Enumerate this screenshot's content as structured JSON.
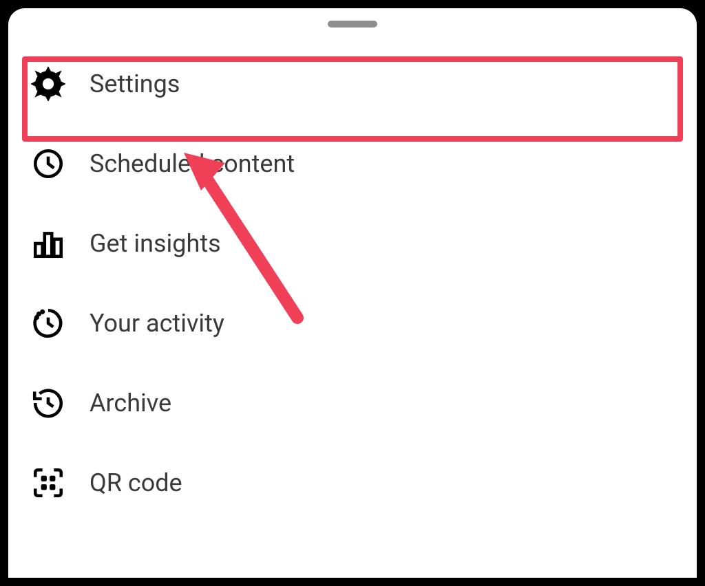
{
  "menu": {
    "items": [
      {
        "icon": "gear",
        "label": "Settings"
      },
      {
        "icon": "clock",
        "label": "Scheduled content"
      },
      {
        "icon": "bar-chart",
        "label": "Get insights"
      },
      {
        "icon": "activity-clock",
        "label": "Your activity"
      },
      {
        "icon": "archive-clock",
        "label": "Archive"
      },
      {
        "icon": "qr",
        "label": "QR code"
      }
    ]
  },
  "annotation": {
    "highlight_color": "#ef4058",
    "arrow_color": "#ef4058",
    "highlighted_item": "Settings"
  }
}
